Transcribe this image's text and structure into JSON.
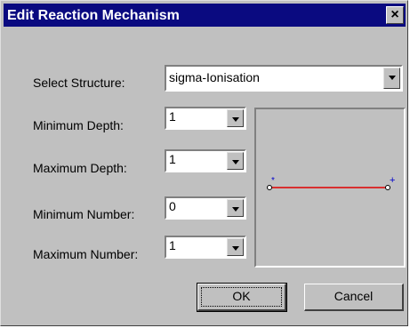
{
  "window": {
    "title": "Edit Reaction Mechanism",
    "close_glyph": "×"
  },
  "fields": {
    "structure": {
      "label": "Select Structure:",
      "value": "sigma-Ionisation"
    },
    "min_depth": {
      "label": "Minimum Depth:",
      "value": "1"
    },
    "max_depth": {
      "label": "Maximum Depth:",
      "value": "1"
    },
    "min_number": {
      "label": "Minimum Number:",
      "value": "0"
    },
    "max_number": {
      "label": "Maximum Number:",
      "value": "1"
    }
  },
  "preview": {
    "left_marker": "*",
    "right_marker": "+",
    "bond_color": "#e00000",
    "marker_color": "#0000cc"
  },
  "buttons": {
    "ok": "OK",
    "cancel": "Cancel"
  }
}
